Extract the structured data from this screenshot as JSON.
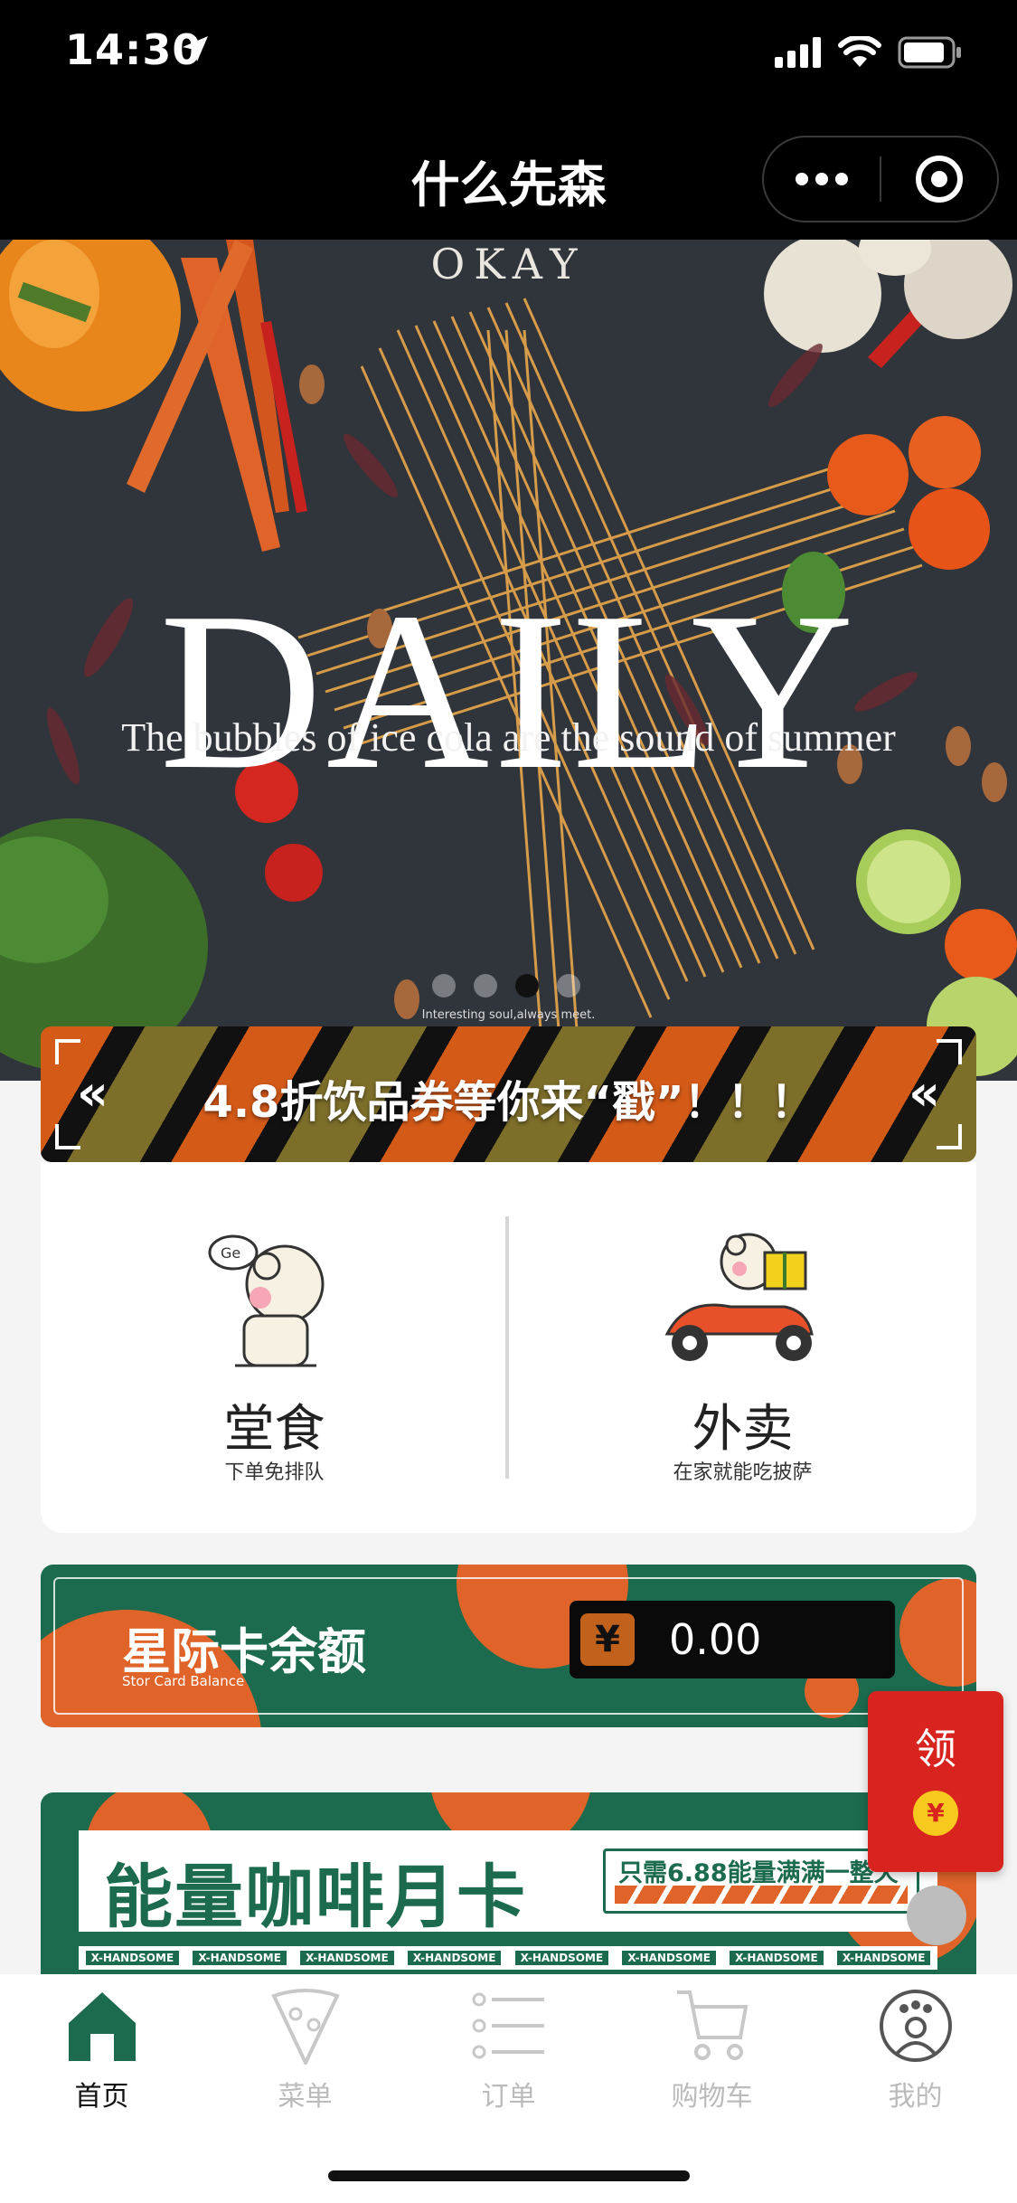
{
  "status_bar": {
    "time": "14:30"
  },
  "nav": {
    "title": "什么先森"
  },
  "banner": {
    "brand": "OKAY",
    "headline": "DAILY",
    "tagline": "The bubbles of ice cola are the sound of summer",
    "small_text": "Interesting soul,always meet.",
    "slide_count": 4,
    "active_slide": 3
  },
  "promo": {
    "text": "4.8折饮品券等你来“戳”！！！"
  },
  "services": [
    {
      "title": "堂食",
      "subtitle": "下单免排队"
    },
    {
      "title": "外卖",
      "subtitle": "在家就能吃披萨"
    }
  ],
  "card_balance": {
    "title": "星际卡余额",
    "subtitle": "Stor Card Balance",
    "currency": "¥",
    "amount": "0.00"
  },
  "coffee_card": {
    "title": "能量咖啡月卡",
    "tag": "只需6.88能量满满一整天",
    "ribbon": "X-HANDSOME"
  },
  "red_packet": {
    "label": "领",
    "coin": "¥"
  },
  "tabs": [
    {
      "label": "首页",
      "icon": "home-icon",
      "active": true
    },
    {
      "label": "菜单",
      "icon": "pizza-icon",
      "active": false
    },
    {
      "label": "订单",
      "icon": "list-icon",
      "active": false
    },
    {
      "label": "购物车",
      "icon": "cart-icon",
      "active": false
    },
    {
      "label": "我的",
      "icon": "profile-icon",
      "active": false
    }
  ],
  "colors": {
    "brand_green": "#1c6b4f",
    "brand_orange": "#e0642a",
    "red_packet": "#d8231f"
  }
}
